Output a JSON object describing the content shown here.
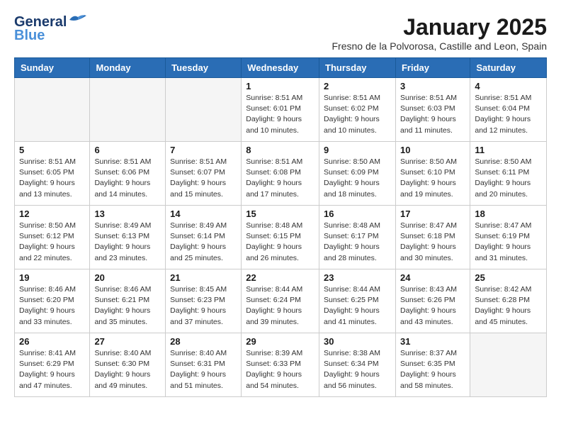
{
  "header": {
    "logo_line1": "General",
    "logo_line2": "Blue",
    "month": "January 2025",
    "location": "Fresno de la Polvorosa, Castille and Leon, Spain"
  },
  "weekdays": [
    "Sunday",
    "Monday",
    "Tuesday",
    "Wednesday",
    "Thursday",
    "Friday",
    "Saturday"
  ],
  "weeks": [
    [
      {
        "day": "",
        "sunrise": "",
        "sunset": "",
        "daylight": ""
      },
      {
        "day": "",
        "sunrise": "",
        "sunset": "",
        "daylight": ""
      },
      {
        "day": "",
        "sunrise": "",
        "sunset": "",
        "daylight": ""
      },
      {
        "day": "1",
        "sunrise": "Sunrise: 8:51 AM",
        "sunset": "Sunset: 6:01 PM",
        "daylight": "Daylight: 9 hours and 10 minutes."
      },
      {
        "day": "2",
        "sunrise": "Sunrise: 8:51 AM",
        "sunset": "Sunset: 6:02 PM",
        "daylight": "Daylight: 9 hours and 10 minutes."
      },
      {
        "day": "3",
        "sunrise": "Sunrise: 8:51 AM",
        "sunset": "Sunset: 6:03 PM",
        "daylight": "Daylight: 9 hours and 11 minutes."
      },
      {
        "day": "4",
        "sunrise": "Sunrise: 8:51 AM",
        "sunset": "Sunset: 6:04 PM",
        "daylight": "Daylight: 9 hours and 12 minutes."
      }
    ],
    [
      {
        "day": "5",
        "sunrise": "Sunrise: 8:51 AM",
        "sunset": "Sunset: 6:05 PM",
        "daylight": "Daylight: 9 hours and 13 minutes."
      },
      {
        "day": "6",
        "sunrise": "Sunrise: 8:51 AM",
        "sunset": "Sunset: 6:06 PM",
        "daylight": "Daylight: 9 hours and 14 minutes."
      },
      {
        "day": "7",
        "sunrise": "Sunrise: 8:51 AM",
        "sunset": "Sunset: 6:07 PM",
        "daylight": "Daylight: 9 hours and 15 minutes."
      },
      {
        "day": "8",
        "sunrise": "Sunrise: 8:51 AM",
        "sunset": "Sunset: 6:08 PM",
        "daylight": "Daylight: 9 hours and 17 minutes."
      },
      {
        "day": "9",
        "sunrise": "Sunrise: 8:50 AM",
        "sunset": "Sunset: 6:09 PM",
        "daylight": "Daylight: 9 hours and 18 minutes."
      },
      {
        "day": "10",
        "sunrise": "Sunrise: 8:50 AM",
        "sunset": "Sunset: 6:10 PM",
        "daylight": "Daylight: 9 hours and 19 minutes."
      },
      {
        "day": "11",
        "sunrise": "Sunrise: 8:50 AM",
        "sunset": "Sunset: 6:11 PM",
        "daylight": "Daylight: 9 hours and 20 minutes."
      }
    ],
    [
      {
        "day": "12",
        "sunrise": "Sunrise: 8:50 AM",
        "sunset": "Sunset: 6:12 PM",
        "daylight": "Daylight: 9 hours and 22 minutes."
      },
      {
        "day": "13",
        "sunrise": "Sunrise: 8:49 AM",
        "sunset": "Sunset: 6:13 PM",
        "daylight": "Daylight: 9 hours and 23 minutes."
      },
      {
        "day": "14",
        "sunrise": "Sunrise: 8:49 AM",
        "sunset": "Sunset: 6:14 PM",
        "daylight": "Daylight: 9 hours and 25 minutes."
      },
      {
        "day": "15",
        "sunrise": "Sunrise: 8:48 AM",
        "sunset": "Sunset: 6:15 PM",
        "daylight": "Daylight: 9 hours and 26 minutes."
      },
      {
        "day": "16",
        "sunrise": "Sunrise: 8:48 AM",
        "sunset": "Sunset: 6:17 PM",
        "daylight": "Daylight: 9 hours and 28 minutes."
      },
      {
        "day": "17",
        "sunrise": "Sunrise: 8:47 AM",
        "sunset": "Sunset: 6:18 PM",
        "daylight": "Daylight: 9 hours and 30 minutes."
      },
      {
        "day": "18",
        "sunrise": "Sunrise: 8:47 AM",
        "sunset": "Sunset: 6:19 PM",
        "daylight": "Daylight: 9 hours and 31 minutes."
      }
    ],
    [
      {
        "day": "19",
        "sunrise": "Sunrise: 8:46 AM",
        "sunset": "Sunset: 6:20 PM",
        "daylight": "Daylight: 9 hours and 33 minutes."
      },
      {
        "day": "20",
        "sunrise": "Sunrise: 8:46 AM",
        "sunset": "Sunset: 6:21 PM",
        "daylight": "Daylight: 9 hours and 35 minutes."
      },
      {
        "day": "21",
        "sunrise": "Sunrise: 8:45 AM",
        "sunset": "Sunset: 6:23 PM",
        "daylight": "Daylight: 9 hours and 37 minutes."
      },
      {
        "day": "22",
        "sunrise": "Sunrise: 8:44 AM",
        "sunset": "Sunset: 6:24 PM",
        "daylight": "Daylight: 9 hours and 39 minutes."
      },
      {
        "day": "23",
        "sunrise": "Sunrise: 8:44 AM",
        "sunset": "Sunset: 6:25 PM",
        "daylight": "Daylight: 9 hours and 41 minutes."
      },
      {
        "day": "24",
        "sunrise": "Sunrise: 8:43 AM",
        "sunset": "Sunset: 6:26 PM",
        "daylight": "Daylight: 9 hours and 43 minutes."
      },
      {
        "day": "25",
        "sunrise": "Sunrise: 8:42 AM",
        "sunset": "Sunset: 6:28 PM",
        "daylight": "Daylight: 9 hours and 45 minutes."
      }
    ],
    [
      {
        "day": "26",
        "sunrise": "Sunrise: 8:41 AM",
        "sunset": "Sunset: 6:29 PM",
        "daylight": "Daylight: 9 hours and 47 minutes."
      },
      {
        "day": "27",
        "sunrise": "Sunrise: 8:40 AM",
        "sunset": "Sunset: 6:30 PM",
        "daylight": "Daylight: 9 hours and 49 minutes."
      },
      {
        "day": "28",
        "sunrise": "Sunrise: 8:40 AM",
        "sunset": "Sunset: 6:31 PM",
        "daylight": "Daylight: 9 hours and 51 minutes."
      },
      {
        "day": "29",
        "sunrise": "Sunrise: 8:39 AM",
        "sunset": "Sunset: 6:33 PM",
        "daylight": "Daylight: 9 hours and 54 minutes."
      },
      {
        "day": "30",
        "sunrise": "Sunrise: 8:38 AM",
        "sunset": "Sunset: 6:34 PM",
        "daylight": "Daylight: 9 hours and 56 minutes."
      },
      {
        "day": "31",
        "sunrise": "Sunrise: 8:37 AM",
        "sunset": "Sunset: 6:35 PM",
        "daylight": "Daylight: 9 hours and 58 minutes."
      },
      {
        "day": "",
        "sunrise": "",
        "sunset": "",
        "daylight": ""
      }
    ]
  ]
}
